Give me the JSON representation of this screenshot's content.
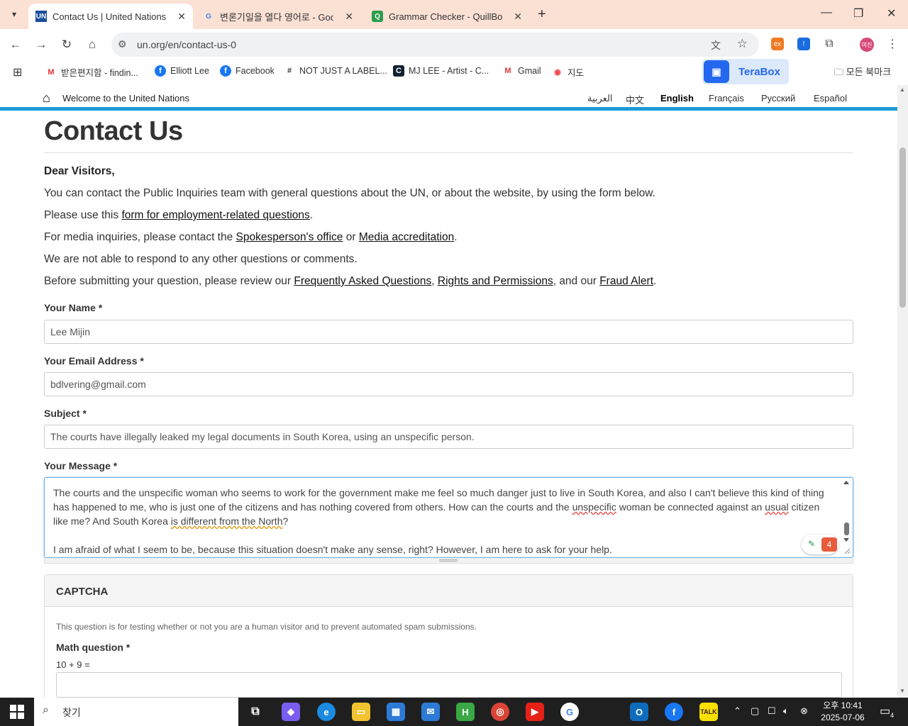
{
  "browser": {
    "tabs": [
      {
        "title": "Contact Us | United Nations",
        "favicon": "UN",
        "active": true
      },
      {
        "title": "변론기일을 열다 영어로 - Goo",
        "favicon": "G",
        "active": false
      },
      {
        "title": "Grammar Checker - QuillBot A",
        "favicon": "Q",
        "active": false
      }
    ],
    "url": "un.org/en/contact-us-0",
    "bookmarks": [
      {
        "label": "받은편지함 - findin...",
        "icon": "M"
      },
      {
        "label": "Elliott Lee",
        "icon": "f"
      },
      {
        "label": "Facebook",
        "icon": "f"
      },
      {
        "label": "NOT JUST A LABEL...",
        "icon": "#"
      },
      {
        "label": "MJ LEE - Artist - C...",
        "icon": "C"
      },
      {
        "label": "Gmail",
        "icon": "M"
      },
      {
        "label": "지도",
        "icon": "◉"
      }
    ],
    "terabox_label": "TeraBox",
    "all_bookmarks": "모든 북마크",
    "profile_initials": "미진"
  },
  "un_bar": {
    "welcome": "Welcome to the United Nations",
    "languages": [
      "العربية",
      "中文",
      "English",
      "Français",
      "Русский",
      "Español"
    ],
    "active_language": "English"
  },
  "page": {
    "title": "Contact Us",
    "greeting": "Dear Visitors,",
    "line1": "You can contact the Public Inquiries team with general questions about the UN, or about the website, by using the form below.",
    "line2_pre": "Please use this ",
    "line2_link": "form for employment-related questions",
    "line2_post": ".",
    "line3_pre": "For media inquiries, please contact the ",
    "line3_link1": "Spokesperson's office",
    "line3_mid": " or ",
    "line3_link2": "Media accreditation",
    "line3_post": ".",
    "line4": "We are not able to respond to any other questions or comments.",
    "line5_pre": "Before submitting your question, please review our ",
    "line5_link1": "Frequently Asked Questions",
    "line5_sep": ", ",
    "line5_link2": "Rights and Permissions",
    "line5_mid": ", and our ",
    "line5_link3": "Fraud Alert",
    "line5_post": "."
  },
  "form": {
    "name_label": "Your Name *",
    "name_value": "Lee Mijin",
    "email_label": "Your Email Address *",
    "email_value": "bdlvering@gmail.com",
    "subject_label": "Subject *",
    "subject_value": "The courts have illegally leaked my legal documents in South Korea, using an unspecific person.",
    "message_label": "Your Message *",
    "message_p1_a": "The courts and the unspecific woman who seems to work for the government make me feel so much danger just to live in South Korea, and also I can't believe this kind of thing has happened to me, who is just one of the citizens and has nothing covered from others. How can the courts and the ",
    "message_p1_err1": "unspecific",
    "message_p1_b": " woman be connected against an ",
    "message_p1_err2": "usual",
    "message_p1_c": " citizen like me? And South Korea ",
    "message_p1_err3": "is different from the North",
    "message_p1_d": "?",
    "message_p2": "I am afraid of what I seem to be, because this situation doesn't make any sense, right? However, I am here to ask for your help.",
    "quillbot_count": "4"
  },
  "captcha": {
    "heading": "CAPTCHA",
    "description": "This question is for testing whether or not you are a human visitor and to prevent automated spam submissions.",
    "math_label": "Math question *",
    "equation": "10 + 9 ="
  },
  "taskbar": {
    "search_placeholder": "찾기",
    "time": "오후 10:41",
    "date": "2025-07-06",
    "notifications": "4"
  }
}
